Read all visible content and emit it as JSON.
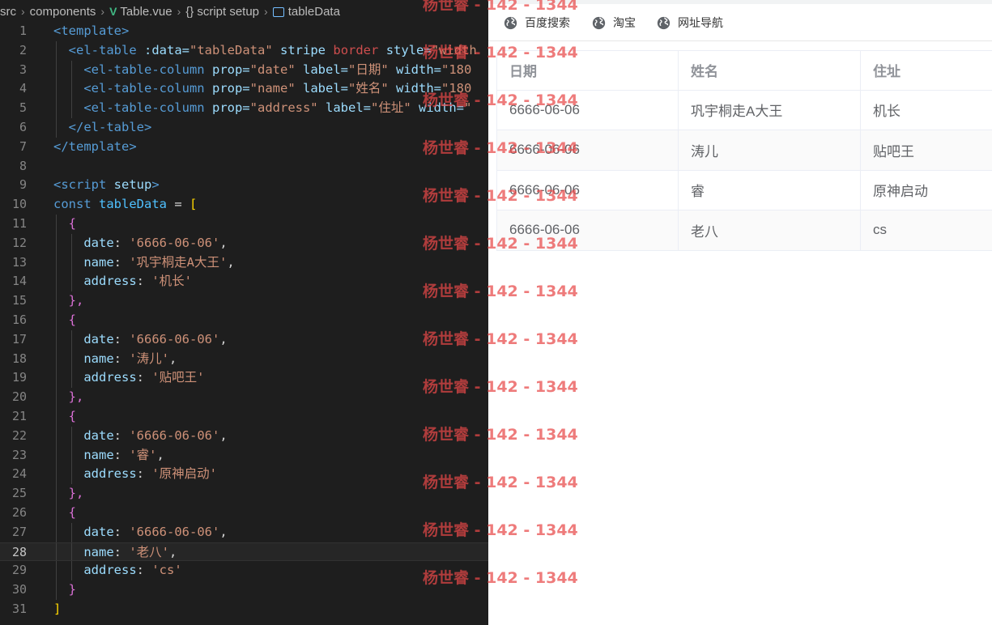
{
  "breadcrumb": {
    "items": [
      "src",
      "components",
      "Table.vue",
      "script setup",
      "tableData"
    ],
    "vue_icon": "V",
    "braces_icon": "{}"
  },
  "code": {
    "current_line": 28,
    "lines": [
      {
        "n": "1"
      },
      {
        "n": "2"
      },
      {
        "n": "3"
      },
      {
        "n": "4"
      },
      {
        "n": "5"
      },
      {
        "n": "6"
      },
      {
        "n": "7"
      },
      {
        "n": "8"
      },
      {
        "n": "9"
      },
      {
        "n": "10"
      },
      {
        "n": "11"
      },
      {
        "n": "12"
      },
      {
        "n": "13"
      },
      {
        "n": "14"
      },
      {
        "n": "15"
      },
      {
        "n": "16"
      },
      {
        "n": "17"
      },
      {
        "n": "18"
      },
      {
        "n": "19"
      },
      {
        "n": "20"
      },
      {
        "n": "21"
      },
      {
        "n": "22"
      },
      {
        "n": "23"
      },
      {
        "n": "24"
      },
      {
        "n": "25"
      },
      {
        "n": "26"
      },
      {
        "n": "27"
      },
      {
        "n": "28"
      },
      {
        "n": "29"
      },
      {
        "n": "30"
      },
      {
        "n": "31"
      }
    ],
    "tokens": {
      "template_open": "<template>",
      "template_close": "</template>",
      "el_table_open": "<el-table",
      "data_attr": ":data=",
      "data_val": "\"tableData\"",
      "stripe": "stripe",
      "border": "border",
      "style_attr": "style=",
      "width_attr": "\"width",
      "col_tag": "<el-table-column",
      "prop_attr": "prop=",
      "label_attr": "label=",
      "width_attr2": "width=",
      "date_val": "\"date\"",
      "name_val": "\"name\"",
      "address_val": "\"address\"",
      "label_date": "\"日期\"",
      "label_name": "\"姓名\"",
      "label_address": "\"住址\"",
      "w180": "\"180",
      "w_quote": "\"",
      "el_table_close": "</el-table>",
      "script_open": "<script",
      "setup": "setup",
      "gt": ">",
      "const": "const",
      "tableData": "tableData",
      "eq": " = ",
      "lbracket": "[",
      "rbracket": "]",
      "lbrace": "{",
      "rbrace_comma": "},",
      "rbrace": "}",
      "date_key": "date",
      "name_key": "name",
      "address_key": "address",
      "colon": ": ",
      "comma": ","
    },
    "rows": [
      {
        "date": "'6666-06-06'",
        "name": "'巩宇桐走A大王'",
        "address": "'机长'"
      },
      {
        "date": "'6666-06-06'",
        "name": "'涛儿'",
        "address": "'贴吧王'"
      },
      {
        "date": "'6666-06-06'",
        "name": "'睿'",
        "address": "'原神启动'"
      },
      {
        "date": "'6666-06-06'",
        "name": "'老八'",
        "address": "'cs'"
      }
    ]
  },
  "browser": {
    "bookmarks": [
      {
        "label": "百度搜索",
        "icon": "globe-icon"
      },
      {
        "label": "淘宝",
        "icon": "globe-icon"
      },
      {
        "label": "网址导航",
        "icon": "globe-icon"
      }
    ],
    "table": {
      "headers": [
        "日期",
        "姓名",
        "住址"
      ],
      "rows": [
        [
          "6666-06-06",
          "巩宇桐走A大王",
          "机长"
        ],
        [
          "6666-06-06",
          "涛儿",
          "贴吧王"
        ],
        [
          "6666-06-06",
          "睿",
          "原神启动"
        ],
        [
          "6666-06-06",
          "老八",
          "cs"
        ]
      ]
    }
  },
  "watermark": {
    "text": "杨世睿 - 142 - 1344",
    "color": "#e84848"
  }
}
